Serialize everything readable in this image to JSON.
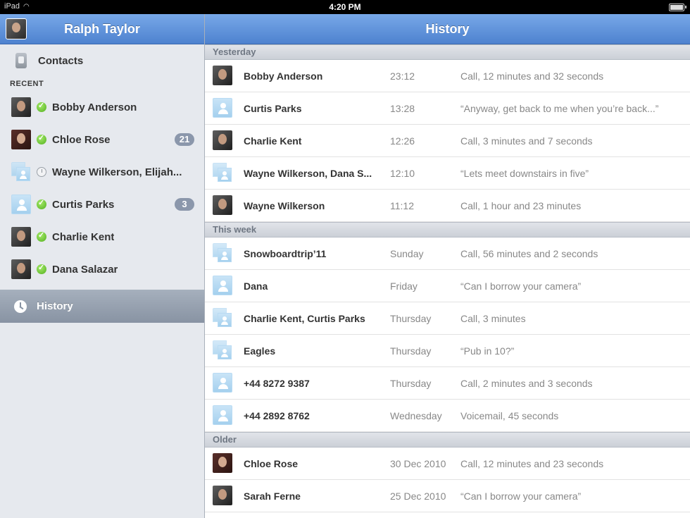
{
  "statusbar": {
    "carrier": "iPad",
    "time": "4:20 PM"
  },
  "sidebar": {
    "user_name": "Ralph Taylor",
    "contacts_label": "Contacts",
    "recent_label": "RECENT",
    "recent": [
      {
        "name": "Bobby Anderson",
        "status": "online",
        "avatar": "photo",
        "badge": ""
      },
      {
        "name": "Chloe Rose",
        "status": "online",
        "avatar": "photo-f",
        "badge": "21"
      },
      {
        "name": "Wayne Wilkerson, Elijah...",
        "status": "offline",
        "avatar": "group",
        "badge": ""
      },
      {
        "name": "Curtis Parks",
        "status": "online",
        "avatar": "default",
        "badge": "3"
      },
      {
        "name": "Charlie Kent",
        "status": "online",
        "avatar": "photo",
        "badge": ""
      },
      {
        "name": "Dana Salazar",
        "status": "online",
        "avatar": "photo",
        "badge": ""
      }
    ],
    "history_label": "History"
  },
  "main": {
    "title": "History",
    "sections": [
      {
        "header": "Yesterday",
        "rows": [
          {
            "name": "Bobby Anderson",
            "time": "23:12",
            "detail": "Call, 12 minutes and 32 seconds",
            "avatar": "photo"
          },
          {
            "name": "Curtis Parks",
            "time": "13:28",
            "detail": "“Anyway, get back to me when you’re back...”",
            "avatar": "default"
          },
          {
            "name": "Charlie Kent",
            "time": "12:26",
            "detail": "Call, 3 minutes and 7 seconds",
            "avatar": "photo"
          },
          {
            "name": "Wayne Wilkerson, Dana S...",
            "time": "12:10",
            "detail": "“Lets meet downstairs in five”",
            "avatar": "group"
          },
          {
            "name": "Wayne Wilkerson",
            "time": "11:12",
            "detail": "Call, 1 hour and 23 minutes",
            "avatar": "photo"
          }
        ]
      },
      {
        "header": "This week",
        "rows": [
          {
            "name": "Snowboardtrip’11",
            "time": "Sunday",
            "detail": "Call, 56 minutes and 2 seconds",
            "avatar": "group"
          },
          {
            "name": "Dana",
            "time": "Friday",
            "detail": "“Can I borrow your camera”",
            "avatar": "default"
          },
          {
            "name": "Charlie Kent, Curtis Parks",
            "time": "Thursday",
            "detail": "Call, 3 minutes",
            "avatar": "group"
          },
          {
            "name": "Eagles",
            "time": "Thursday",
            "detail": "“Pub in 10?”",
            "avatar": "group"
          },
          {
            "name": "+44 8272 9387",
            "time": "Thursday",
            "detail": "Call, 2 minutes and 3 seconds",
            "avatar": "default"
          },
          {
            "name": "+44 2892 8762",
            "time": "Wednesday",
            "detail": "Voicemail, 45 seconds",
            "avatar": "default"
          }
        ]
      },
      {
        "header": "Older",
        "rows": [
          {
            "name": "Chloe Rose",
            "time": "30 Dec 2010",
            "detail": "Call, 12 minutes and 23 seconds",
            "avatar": "photo-f"
          },
          {
            "name": "Sarah Ferne",
            "time": "25 Dec 2010",
            "detail": "“Can I borrow your camera”",
            "avatar": "photo"
          }
        ]
      }
    ]
  }
}
